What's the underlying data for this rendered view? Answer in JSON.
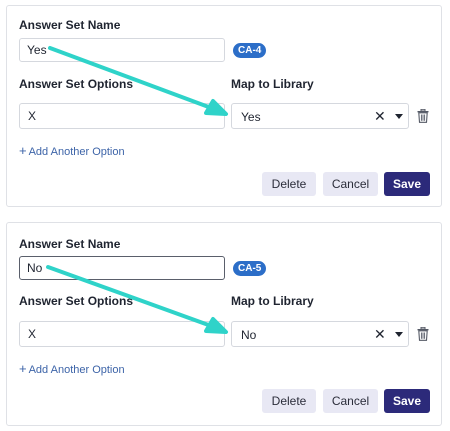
{
  "forms": [
    {
      "name_label": "Answer Set Name",
      "name_value": "Yes",
      "tag": "CA-4",
      "options_label": "Answer Set Options",
      "library_label": "Map to Library",
      "option_value": "X",
      "library_value": "Yes",
      "clear_glyph": "✕",
      "add_option": "Add Another Option",
      "delete_label": "Delete",
      "cancel_label": "Cancel",
      "save_label": "Save"
    },
    {
      "name_label": "Answer Set Name",
      "name_value": "No",
      "tag": "CA-5",
      "options_label": "Answer Set Options",
      "library_label": "Map to Library",
      "option_value": "X",
      "library_value": "No",
      "clear_glyph": "✕",
      "add_option": "Add Another Option",
      "delete_label": "Delete",
      "cancel_label": "Cancel",
      "save_label": "Save"
    }
  ],
  "colors": {
    "arrow": "#2fd3c9",
    "tag": "#2c6ec8",
    "primary_button": "#2c2a7a",
    "secondary_button": "#e8e8f4",
    "link": "#3d64a8"
  },
  "icons": {
    "trash": "trash-icon",
    "clear": "clear-icon",
    "dropdown": "chevron-down-icon",
    "plus": "plus-icon"
  }
}
